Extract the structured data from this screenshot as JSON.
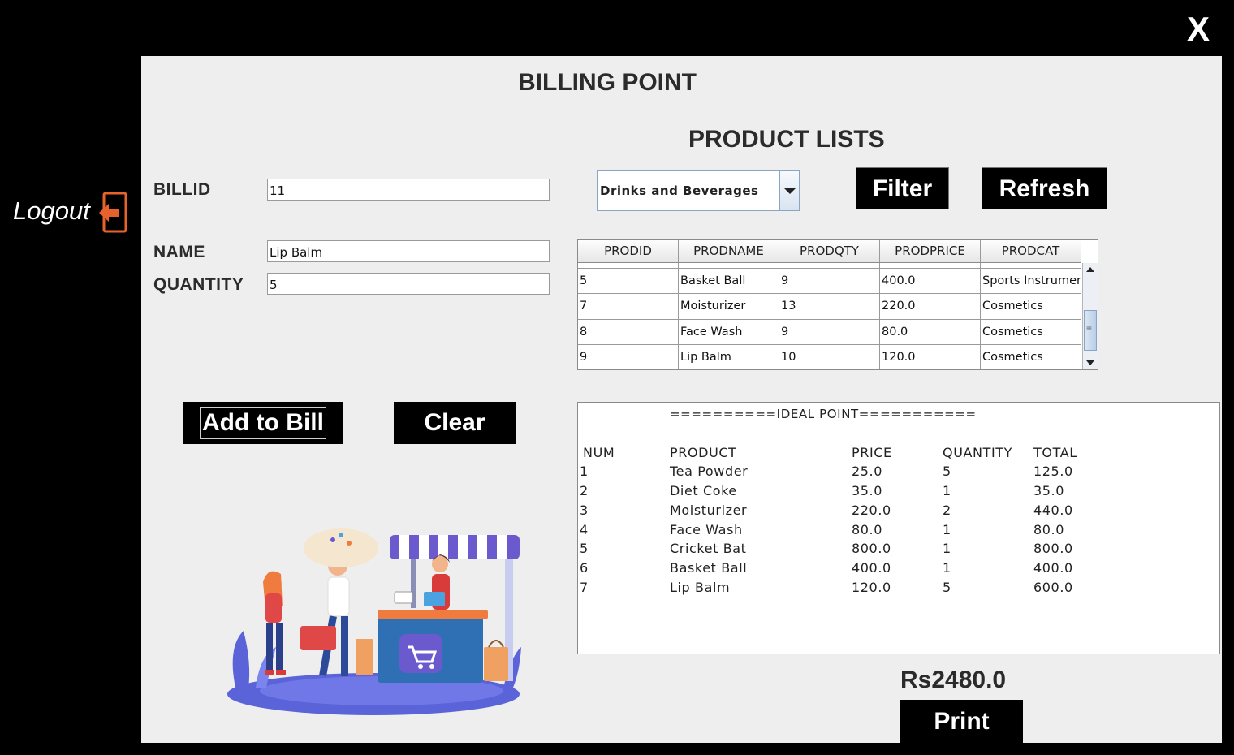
{
  "window": {
    "close_label": "X"
  },
  "logout": {
    "label": "Logout"
  },
  "header": {
    "title": "BILLING POINT",
    "product_lists_title": "PRODUCT LISTS"
  },
  "form": {
    "billid_label": "BILLID",
    "billid_value": "11",
    "name_label": "NAME",
    "name_value": "Lip Balm",
    "quantity_label": "QUANTITY",
    "quantity_value": "5"
  },
  "filter": {
    "selected_category": "Drinks and Beverages",
    "filter_label": "Filter",
    "refresh_label": "Refresh"
  },
  "product_table": {
    "columns": [
      "PRODID",
      "PRODNAME",
      "PRODQTY",
      "PRODPRICE",
      "PRODCAT"
    ],
    "rows": [
      [
        "5",
        "Basket Ball",
        "9",
        "400.0",
        "Sports Instrumen..."
      ],
      [
        "7",
        "Moisturizer",
        "13",
        "220.0",
        "Cosmetics"
      ],
      [
        "8",
        "Face Wash",
        "9",
        "80.0",
        "Cosmetics"
      ],
      [
        "9",
        "Lip Balm",
        "10",
        "120.0",
        "Cosmetics"
      ]
    ]
  },
  "actions": {
    "add_label": "Add to Bill",
    "clear_label": "Clear",
    "print_label": "Print"
  },
  "bill": {
    "banner": "==========IDEAL POINT===========",
    "columns": [
      "NUM",
      "PRODUCT",
      "PRICE",
      "QUANTITY",
      "TOTAL"
    ],
    "rows": [
      [
        "1",
        "Tea Powder",
        "25.0",
        "5",
        "125.0"
      ],
      [
        "2",
        "Diet Coke",
        "35.0",
        "1",
        "35.0"
      ],
      [
        "3",
        "Moisturizer",
        "220.0",
        "2",
        "440.0"
      ],
      [
        "4",
        "Face Wash",
        "80.0",
        "1",
        "80.0"
      ],
      [
        "5",
        "Cricket Bat",
        "800.0",
        "1",
        "800.0"
      ],
      [
        "6",
        "Basket Ball",
        "400.0",
        "1",
        "400.0"
      ],
      [
        "7",
        "Lip Balm",
        "120.0",
        "5",
        "600.0"
      ]
    ]
  },
  "grand_total": "Rs2480.0",
  "icons": {
    "logout": "logout-arrow-icon",
    "illustration": "shop-illustration"
  },
  "colors": {
    "accent_orange": "#e8632b",
    "background": "#000000",
    "panel": "#eeeeee"
  }
}
